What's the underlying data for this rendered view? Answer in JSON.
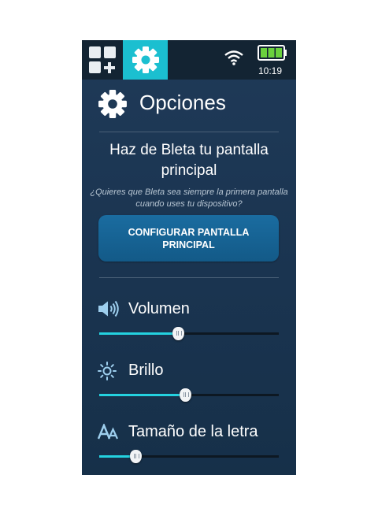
{
  "statusbar": {
    "time": "10:19",
    "battery_level": 1.0
  },
  "header": {
    "title": "Opciones"
  },
  "home_section": {
    "title": "Haz de Bleta tu pantalla principal",
    "description": "¿Quieres que Bleta sea siempre la primera pantalla cuando uses tu dispositivo?",
    "button_label": "CONFIGURAR PANTALLA PRINCIPAL"
  },
  "settings": [
    {
      "id": "volume",
      "label": "Volumen",
      "icon": "speaker-icon",
      "value": 0.44
    },
    {
      "id": "brightness",
      "label": "Brillo",
      "icon": "sun-icon",
      "value": 0.48
    },
    {
      "id": "font_size",
      "label": "Tamaño de la letra",
      "icon": "font-size-icon",
      "value": 0.2
    }
  ],
  "colors": {
    "accent": "#24d2e0",
    "tab_active": "#1bbfd0",
    "background": "#1c3652",
    "button": "#176597"
  }
}
